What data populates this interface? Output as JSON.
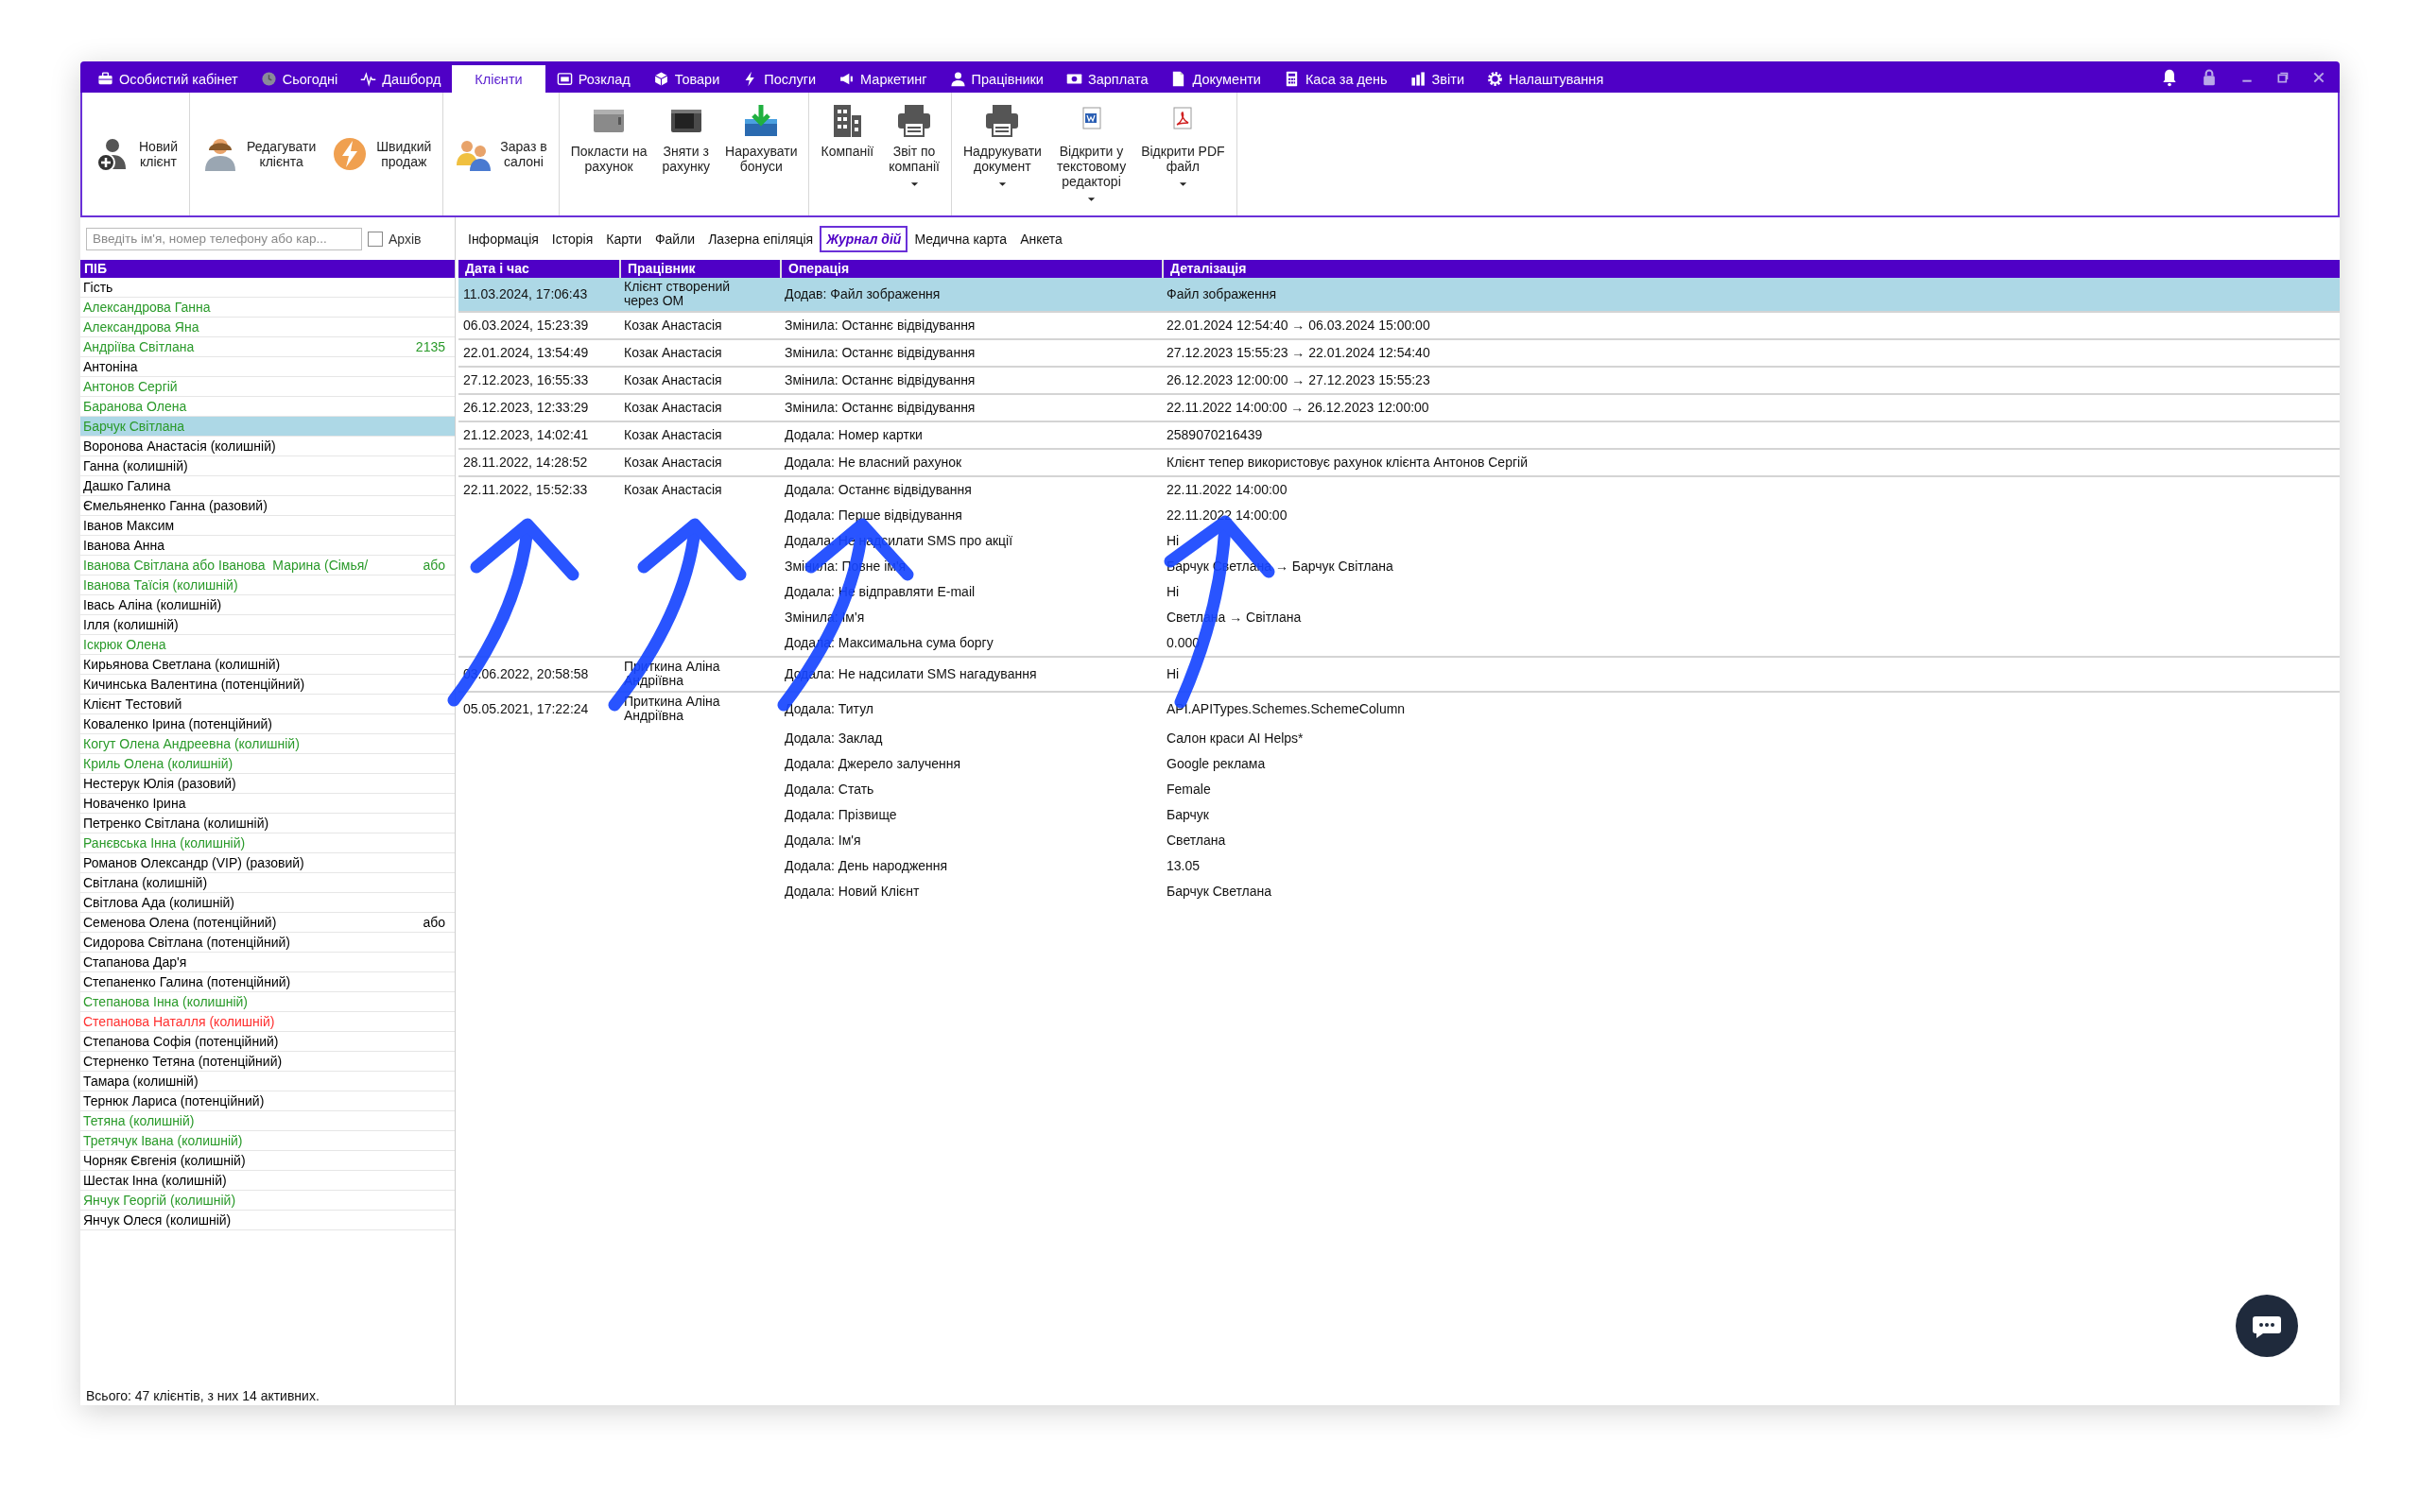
{
  "menu": [
    {
      "label": "Особистий кабінет",
      "selected": false
    },
    {
      "label": "Сьогодні",
      "selected": false
    },
    {
      "label": "Дашборд",
      "selected": false
    },
    {
      "label": "Клієнти",
      "selected": true
    },
    {
      "label": "Розклад",
      "selected": false
    },
    {
      "label": "Товари",
      "selected": false
    },
    {
      "label": "Послуги",
      "selected": false
    },
    {
      "label": "Маркетинг",
      "selected": false
    },
    {
      "label": "Працівники",
      "selected": false
    },
    {
      "label": "Зарплата",
      "selected": false
    },
    {
      "label": "Документи",
      "selected": false
    },
    {
      "label": "Каса за день",
      "selected": false
    },
    {
      "label": "Звіти",
      "selected": false
    },
    {
      "label": "Налаштування",
      "selected": false
    }
  ],
  "toolbar": [
    {
      "kind": "inline",
      "buttons": [
        {
          "lines": [
            "Новий",
            "клієнт"
          ],
          "menu": false
        }
      ]
    },
    {
      "kind": "inline",
      "buttons": [
        {
          "lines": [
            "Редагувати",
            "клієнта"
          ],
          "menu": false
        },
        {
          "lines": [
            "Швидкий",
            "продаж"
          ],
          "menu": false
        }
      ]
    },
    {
      "kind": "inline",
      "buttons": [
        {
          "lines": [
            "Зараз в",
            "салоні"
          ],
          "menu": false
        }
      ]
    },
    {
      "kind": "stacked",
      "buttons": [
        {
          "lines": [
            "Покласти на",
            "рахунок"
          ],
          "menu": false
        },
        {
          "lines": [
            "Зняти з",
            "рахунку"
          ],
          "menu": false
        },
        {
          "lines": [
            "Нарахувати",
            "бонуси"
          ],
          "menu": false
        }
      ]
    },
    {
      "kind": "stacked",
      "buttons": [
        {
          "lines": [
            "Компанії"
          ],
          "menu": false
        },
        {
          "lines": [
            "Звіт по",
            "компанії"
          ],
          "menu": true
        }
      ]
    },
    {
      "kind": "stacked",
      "buttons": [
        {
          "lines": [
            "Надрукувати",
            "документ"
          ],
          "menu": true
        },
        {
          "lines": [
            "Відкрити у",
            "текстовому",
            "редакторі"
          ],
          "menu": true
        },
        {
          "lines": [
            "Відкрити PDF",
            "файл"
          ],
          "menu": true
        }
      ]
    }
  ],
  "search": {
    "placeholder": "Введіть ім'я, номер телефону або кар..."
  },
  "archive": {
    "label": "Архів",
    "checked": false
  },
  "detail_tabs": [
    {
      "label": "Інформація",
      "selected": false
    },
    {
      "label": "Історія",
      "selected": false
    },
    {
      "label": "Карти",
      "selected": false
    },
    {
      "label": "Файли",
      "selected": false
    },
    {
      "label": "Лазерна епіляція",
      "selected": false
    },
    {
      "label": "Журнал дій",
      "selected": true
    },
    {
      "label": "Медична карта",
      "selected": false
    },
    {
      "label": "Анкета",
      "selected": false
    }
  ],
  "clients": {
    "header": "ПІБ",
    "footer": "Всього: 47 клієнтів, з них 14 активних.",
    "items": [
      {
        "name": "Гість",
        "color": "#000000",
        "selected": false
      },
      {
        "name": "Александрова Ганна",
        "color": "#2a9a2a",
        "selected": false
      },
      {
        "name": "Александрова Яна",
        "color": "#2a9a2a",
        "selected": false
      },
      {
        "name": "Андріїва Світлана",
        "color": "#2a9a2a",
        "selected": false,
        "extra": "2135"
      },
      {
        "name": "Антоніна",
        "color": "#000000",
        "selected": false
      },
      {
        "name": "Антонов Сергій",
        "color": "#2a9a2a",
        "selected": false
      },
      {
        "name": "Баранова Олена",
        "color": "#2a9a2a",
        "selected": false
      },
      {
        "name": "Барчук Світлана",
        "color": "#2a9a2a",
        "selected": true
      },
      {
        "name": "Воронова Анастасія (колишній)",
        "color": "#000000",
        "selected": false
      },
      {
        "name": "Ганна (колишній)",
        "color": "#000000",
        "selected": false
      },
      {
        "name": "Дашко Галина",
        "color": "#000000",
        "selected": false
      },
      {
        "name": "Ємельяненко Ганна (разовий)",
        "color": "#000000",
        "selected": false
      },
      {
        "name": "Іванов Максим",
        "color": "#000000",
        "selected": false
      },
      {
        "name": "Іванова Анна",
        "color": "#000000",
        "selected": false
      },
      {
        "name": "Іванова Світлана або Іванова  Марина (Сімья/",
        "color": "#2a9a2a",
        "selected": false,
        "extra": "або"
      },
      {
        "name": "Іванова Таїсія (колишній)",
        "color": "#2a9a2a",
        "selected": false
      },
      {
        "name": "Івась Аліна (колишній)",
        "color": "#000000",
        "selected": false
      },
      {
        "name": "Ілля (колишній)",
        "color": "#000000",
        "selected": false
      },
      {
        "name": "Іскрюк Олена",
        "color": "#2a9a2a",
        "selected": false
      },
      {
        "name": "Кирьянова Светлана (колишній)",
        "color": "#000000",
        "selected": false
      },
      {
        "name": "Кичинська Валентина (потенційний)",
        "color": "#000000",
        "selected": false
      },
      {
        "name": "Клієнт Тестовий",
        "color": "#000000",
        "selected": false
      },
      {
        "name": "Коваленко Ірина (потенційний)",
        "color": "#000000",
        "selected": false
      },
      {
        "name": "Когут Олена Андреевна (колишній)",
        "color": "#2a9a2a",
        "selected": false
      },
      {
        "name": "Криль Олена (колишній)",
        "color": "#2a9a2a",
        "selected": false
      },
      {
        "name": "Нестерук Юлія (разовий)",
        "color": "#000000",
        "selected": false
      },
      {
        "name": "Новаченко Ірина",
        "color": "#000000",
        "selected": false
      },
      {
        "name": "Петренко Світлана (колишній)",
        "color": "#000000",
        "selected": false
      },
      {
        "name": "Ранєвська Інна (колишній)",
        "color": "#2a9a2a",
        "selected": false
      },
      {
        "name": "Романов Олександр (VIP) (разовий)",
        "color": "#000000",
        "selected": false
      },
      {
        "name": "Світлана (колишній)",
        "color": "#000000",
        "selected": false
      },
      {
        "name": "Світлова Ада (колишній)",
        "color": "#000000",
        "selected": false
      },
      {
        "name": "Семенова Олена (потенційний)",
        "color": "#000000",
        "selected": false,
        "extra": "або"
      },
      {
        "name": "Сидорова Світлана (потенційний)",
        "color": "#000000",
        "selected": false
      },
      {
        "name": "Стапанова Дар'я",
        "color": "#000000",
        "selected": false
      },
      {
        "name": "Степаненко Галина (потенційний)",
        "color": "#000000",
        "selected": false
      },
      {
        "name": "Степанова Інна (колишній)",
        "color": "#2a9a2a",
        "selected": false
      },
      {
        "name": "Степанова Наталля (колишній)",
        "color": "#ff3030",
        "selected": false
      },
      {
        "name": "Степанова Софія (потенційний)",
        "color": "#000000",
        "selected": false
      },
      {
        "name": "Стерненко Тетяна (потенційний)",
        "color": "#000000",
        "selected": false
      },
      {
        "name": "Тамара (колишній)",
        "color": "#000000",
        "selected": false
      },
      {
        "name": "Тернюк Лариса (потенційний)",
        "color": "#000000",
        "selected": false
      },
      {
        "name": "Тетяна (колишній)",
        "color": "#2a9a2a",
        "selected": false
      },
      {
        "name": "Третячук Івана (колишній)",
        "color": "#2a9a2a",
        "selected": false
      },
      {
        "name": "Чорняк Євгенія (колишній)",
        "color": "#000000",
        "selected": false
      },
      {
        "name": "Шестак Інна (колишній)",
        "color": "#000000",
        "selected": false
      },
      {
        "name": "Янчук Георгій (колишній)",
        "color": "#2a9a2a",
        "selected": false
      },
      {
        "name": "Янчук Олеся (колишній)",
        "color": "#000000",
        "selected": false
      }
    ]
  },
  "journal": {
    "columns": [
      "Дата і час",
      "Працівник",
      "Операція",
      "Деталізація"
    ],
    "rows": [
      {
        "date": "11.03.2024, 17:06:43",
        "worker": "Клієнт створений через ОМ",
        "selected": true,
        "entries": [
          {
            "operation": "Додав: Файл зображення",
            "detail": "Файл зображення"
          }
        ]
      },
      {
        "date": "06.03.2024, 15:23:39",
        "worker": "Козак Анастасія",
        "selected": false,
        "entries": [
          {
            "operation": "Змінила: Останнє відвідування",
            "detail": "22.01.2024 12:54:40 → 06.03.2024 15:00:00"
          }
        ]
      },
      {
        "date": "22.01.2024, 13:54:49",
        "worker": "Козак Анастасія",
        "selected": false,
        "entries": [
          {
            "operation": "Змінила: Останнє відвідування",
            "detail": "27.12.2023 15:55:23 → 22.01.2024 12:54:40"
          }
        ]
      },
      {
        "date": "27.12.2023, 16:55:33",
        "worker": "Козак Анастасія",
        "selected": false,
        "entries": [
          {
            "operation": "Змінила: Останнє відвідування",
            "detail": "26.12.2023 12:00:00 → 27.12.2023 15:55:23"
          }
        ]
      },
      {
        "date": "26.12.2023, 12:33:29",
        "worker": "Козак Анастасія",
        "selected": false,
        "entries": [
          {
            "operation": "Змінила: Останнє відвідування",
            "detail": "22.11.2022 14:00:00 → 26.12.2023 12:00:00"
          }
        ]
      },
      {
        "date": "21.12.2023, 14:02:41",
        "worker": "Козак Анастасія",
        "selected": false,
        "entries": [
          {
            "operation": "Додала: Номер картки",
            "detail": "2589070216439"
          }
        ]
      },
      {
        "date": "28.11.2022, 14:28:52",
        "worker": "Козак Анастасія",
        "selected": false,
        "entries": [
          {
            "operation": "Додала: Не власний рахунок",
            "detail": "Клієнт тепер використовує рахунок клієнта Антонов Сергій"
          }
        ]
      },
      {
        "date": "22.11.2022, 15:52:33",
        "worker": "Козак Анастасія",
        "selected": false,
        "entries": [
          {
            "operation": "Додала: Останнє відвідування",
            "detail": "22.11.2022 14:00:00"
          },
          {
            "operation": "Додала: Перше відвідування",
            "detail": "22.11.2022 14:00:00"
          },
          {
            "operation": "Додала: Не надсилати SMS про акції",
            "detail": "Ні"
          },
          {
            "operation": "Змінила: Повне ім'я",
            "detail": "Барчук Светлана → Барчук Світлана"
          },
          {
            "operation": "Додала: Не відправляти E-mail",
            "detail": "Ні"
          },
          {
            "operation": "Змінила: Ім'я",
            "detail": "Светлана → Світлана"
          },
          {
            "operation": "Додала: Максимальна сума боргу",
            "detail": "0.000"
          }
        ]
      },
      {
        "date": "03.06.2022, 20:58:58",
        "worker": "Приткина Аліна Андріївна",
        "selected": false,
        "entries": [
          {
            "operation": "Додала: Не надсилати SMS нагадування",
            "detail": "Ні"
          }
        ]
      },
      {
        "date": "05.05.2021, 17:22:24",
        "worker": "Приткина Аліна Андріївна",
        "selected": false,
        "entries": [
          {
            "operation": "Додала: Титул",
            "detail": "API.APITypes.Schemes.SchemeColumn"
          },
          {
            "operation": "Додала: Заклад",
            "detail": "Салон краси AI Helps*"
          },
          {
            "operation": "Додала: Джерело залучення",
            "detail": "Google реклама"
          },
          {
            "operation": "Додала: Стать",
            "detail": "Female"
          },
          {
            "operation": "Додала: Прізвище",
            "detail": "Барчук"
          },
          {
            "operation": "Додала: Ім'я",
            "detail": "Светлана"
          },
          {
            "operation": "Додала: День народження",
            "detail": "13.05"
          },
          {
            "operation": "Додала: Новий Клієнт",
            "detail": "Барчук Светлана"
          }
        ]
      }
    ]
  }
}
